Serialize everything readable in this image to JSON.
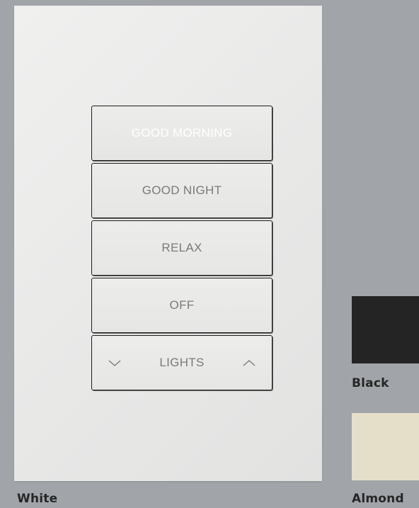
{
  "keypad": {
    "buttons": [
      {
        "label": "GOOD MORNING",
        "state": "active"
      },
      {
        "label": "GOOD NIGHT"
      },
      {
        "label": "RELAX"
      },
      {
        "label": "OFF"
      },
      {
        "label": "LIGHTS"
      }
    ],
    "lights_down_icon": "chevron-down-icon",
    "lights_up_icon": "chevron-up-icon"
  },
  "finishes": [
    {
      "label": "White",
      "color": "#e9e9e8"
    },
    {
      "label": "Black",
      "color": "#242424"
    },
    {
      "label": "Almond",
      "color": "#e5dfc9"
    }
  ],
  "colors": {
    "background": "#a1a5aa",
    "active_text": "#ffffff",
    "inactive_text": "#7a7a7a"
  }
}
